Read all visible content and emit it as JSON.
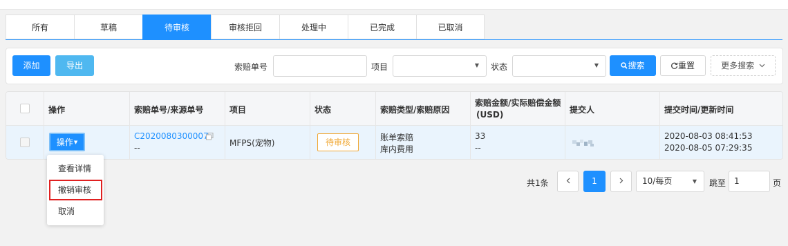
{
  "tabs": [
    "所有",
    "草稿",
    "待审核",
    "审核拒回",
    "处理中",
    "已完成",
    "已取消"
  ],
  "active_tab_index": 2,
  "toolbar": {
    "add_label": "添加",
    "export_label": "导出",
    "claim_no_label": "索赔单号",
    "project_label": "项目",
    "status_label": "状态",
    "search_label": "搜索",
    "reset_label": "重置",
    "more_search_label": "更多搜索"
  },
  "table": {
    "headers": {
      "op": "操作",
      "claim_no": "索赔单号/来源单号",
      "project": "项目",
      "status": "状态",
      "type": "索赔类型/索赔原因",
      "amount_line1": "索赔金额/实际赔偿金额",
      "amount_line2": "(USD)",
      "submitter": "提交人",
      "time": "提交时间/更新时间"
    },
    "row": {
      "op_button": "操作",
      "claim_no": "C2020080300007",
      "source_no": "--",
      "project": "MFPS(宠物)",
      "status": "待审核",
      "claim_type": "账单索赔",
      "claim_reason": "库内费用",
      "claim_amount": "33",
      "actual_amount": "--",
      "submit_time": "2020-08-03 08:41:53",
      "update_time": "2020-08-05 07:29:35"
    }
  },
  "dropdown": {
    "items": [
      "查看详情",
      "撤销审核",
      "取消"
    ],
    "highlighted_index": 1
  },
  "pagination": {
    "total": "共1条",
    "current_page": "1",
    "page_size": "10/每页",
    "jump_label": "跳至",
    "jump_value": "1",
    "page_suffix": "页"
  },
  "colors": {
    "accent": "#1e90ff",
    "pending": "#f0a732",
    "highlight_border": "#e02020"
  }
}
